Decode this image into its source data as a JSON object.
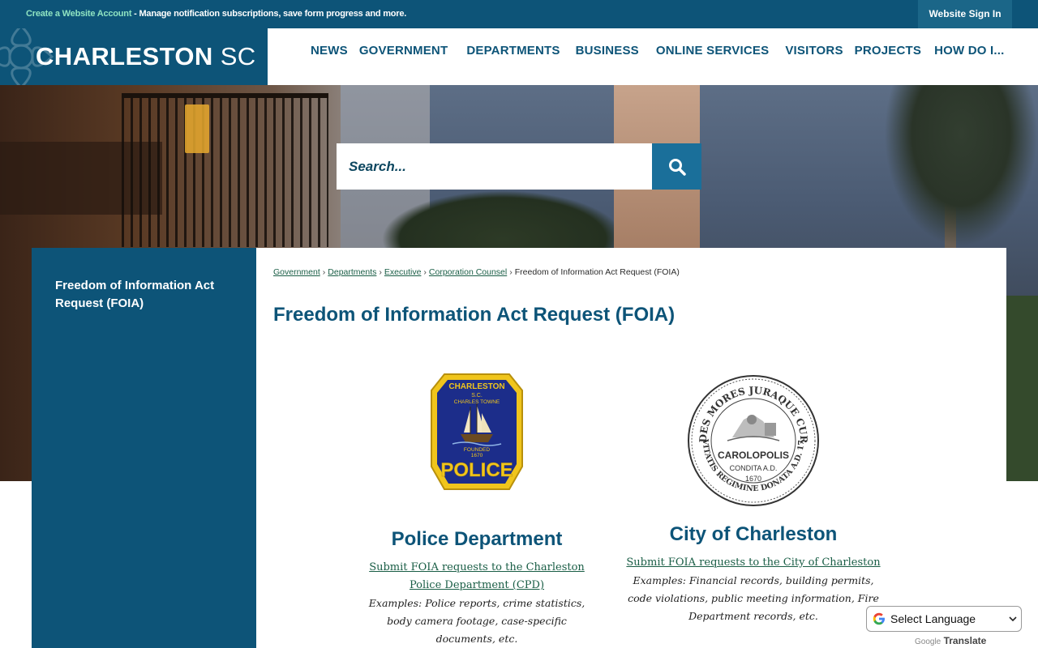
{
  "topbar": {
    "account_link": "Create a Website Account",
    "account_message": " - Manage notification subscriptions, save form progress and more.",
    "sign_in": "Website Sign In"
  },
  "logo": {
    "city": "CHARLESTON",
    "state": "SC"
  },
  "nav": {
    "items": [
      "NEWS",
      "GOVERNMENT",
      "DEPARTMENTS",
      "BUSINESS",
      "ONLINE SERVICES",
      "VISITORS",
      "PROJECTS",
      "HOW DO I..."
    ]
  },
  "search": {
    "placeholder": "Search...",
    "button_icon": "search-icon"
  },
  "sidebar": {
    "link": "Freedom of Information Act Request (FOIA)"
  },
  "breadcrumb": {
    "items": [
      "Government",
      "Departments",
      "Executive",
      "Corporation Counsel"
    ],
    "current": "Freedom of Information Act Request (FOIA)",
    "separator": "›"
  },
  "page": {
    "title": "Freedom of Information Act Request (FOIA)"
  },
  "cards": [
    {
      "title": "Police Department",
      "link": "Submit FOIA requests to the Charleston Police Department (CPD)",
      "description": "Examples: Police reports, crime statistics, body camera footage, case-specific documents, etc.",
      "badge": {
        "top": "CHARLESTON",
        "sub1": "S.C.",
        "sub2": "CHARLES TOWNE",
        "founded": "FOUNDED",
        "year": "1670",
        "word": "POLICE"
      }
    },
    {
      "title": "City of Charleston",
      "link": "Submit FOIA requests to the City of Charleston",
      "description": "Examples: Financial records, building permits, code violations, public meeting information, Fire Department records, etc.",
      "seal": {
        "top": "AEDES MORES JURAQUE CURAT",
        "bottom": "CIVITATIS REGIMINE DONATA A.D. 1783",
        "name": "CAROLOPOLIS",
        "condita": "CONDITA A.D.",
        "year": "1670"
      }
    }
  ],
  "translate": {
    "label": "Select Language",
    "powered_google": "Google",
    "powered_translate": "Translate"
  },
  "colors": {
    "brand": "#0d5478",
    "link": "#1a5e46",
    "accent_green": "#8fe3c1",
    "search_button": "#1a6f9a"
  }
}
